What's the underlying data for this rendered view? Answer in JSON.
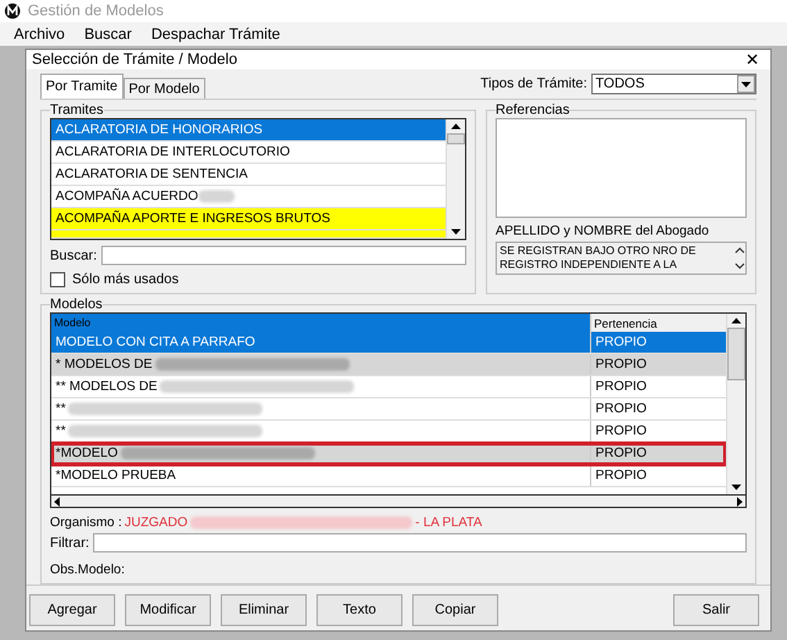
{
  "app": {
    "title": "Gestión de Modelos",
    "menu": [
      "Archivo",
      "Buscar",
      "Despachar Trámite"
    ]
  },
  "dialog": {
    "title": "Selección de Trámite / Modelo",
    "close": "✕",
    "tabs": [
      {
        "label": "Por Tramite",
        "selected": true
      },
      {
        "label": "Por Modelo",
        "selected": false
      }
    ],
    "tipos": {
      "label": "Tipos de Trámite:",
      "value": "TODOS"
    },
    "tramites": {
      "title": "Tramites",
      "rows": [
        {
          "label": "ACLARATORIA DE HONORARIOS",
          "selected": true,
          "highlighted": false,
          "redacted": false
        },
        {
          "label": "ACLARATORIA DE INTERLOCUTORIO",
          "selected": false,
          "highlighted": false,
          "redacted": false
        },
        {
          "label": "ACLARATORIA DE SENTENCIA",
          "selected": false,
          "highlighted": false,
          "redacted": false
        },
        {
          "label": "ACOMPAÑA ACUERDO",
          "selected": false,
          "highlighted": false,
          "redacted": true
        },
        {
          "label": "ACOMPAÑA APORTE E INGRESOS BRUTOS",
          "selected": false,
          "highlighted": true,
          "redacted": false
        },
        {
          "selected": false,
          "highlighted": true
        }
      ],
      "search_label": "Buscar:",
      "checkbox": {
        "label": "Sólo más usados",
        "checked": false
      }
    },
    "referencias": {
      "title": "Referencias",
      "abogado_label": "APELLIDO y NOMBRE del Abogado",
      "abogado_text": "SE REGISTRAN BAJO OTRO NRO DE REGISTRO INDEPENDIENTE  A LA"
    },
    "modelos": {
      "title": "Modelos",
      "columns": [
        "Modelo",
        "Pertenencia"
      ],
      "rows": [
        {
          "modelo": "MODELO CON CITA A PARRAFO",
          "pertenencia": "PROPIO",
          "selected": true,
          "shaded": false,
          "outlined": false,
          "redacted": false
        },
        {
          "modelo": "* MODELOS DE",
          "pertenencia": "PROPIO",
          "selected": false,
          "shaded": true,
          "outlined": false,
          "redacted": true
        },
        {
          "modelo": "** MODELOS DE",
          "pertenencia": "PROPIO",
          "selected": false,
          "shaded": false,
          "outlined": false,
          "redacted": true
        },
        {
          "modelo": "**",
          "pertenencia": "PROPIO",
          "selected": false,
          "shaded": false,
          "outlined": false,
          "redacted": true
        },
        {
          "modelo": "**",
          "pertenencia": "PROPIO",
          "selected": false,
          "shaded": false,
          "outlined": false,
          "redacted": true
        },
        {
          "modelo": "*MODELO",
          "pertenencia": "PROPIO",
          "selected": false,
          "shaded": true,
          "outlined": true,
          "redacted": true
        },
        {
          "modelo": "*MODELO PRUEBA",
          "pertenencia": "PROPIO",
          "selected": false,
          "shaded": false,
          "outlined": false,
          "redacted": false
        }
      ],
      "organismo_label": "Organismo :",
      "organismo_start": "JUZGADO",
      "organismo_end": "- LA PLATA",
      "filtrar_label": "Filtrar:",
      "obs_label": "Obs.Modelo:"
    },
    "buttons": [
      "Agregar",
      "Modificar",
      "Eliminar",
      "Texto",
      "Copiar"
    ],
    "exit_button": "Salir"
  }
}
